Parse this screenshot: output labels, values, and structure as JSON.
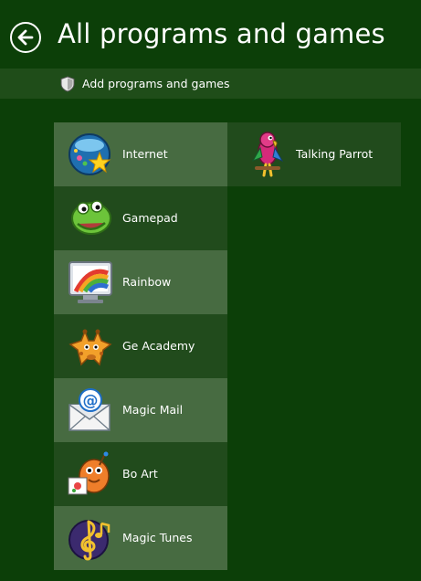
{
  "header": {
    "title": "All programs and games"
  },
  "add_bar": {
    "label": "Add programs and games"
  },
  "programs": [
    {
      "label": "Internet",
      "icon": "globe-star-icon"
    },
    {
      "label": "Gamepad",
      "icon": "snake-icon"
    },
    {
      "label": "Rainbow",
      "icon": "rainbow-monitor-icon"
    },
    {
      "label": "Ge Academy",
      "icon": "giraffe-icon"
    },
    {
      "label": "Magic Mail",
      "icon": "envelope-at-icon"
    },
    {
      "label": "Bo Art",
      "icon": "paint-creature-icon"
    },
    {
      "label": "Magic Tunes",
      "icon": "treble-clef-icon"
    },
    {
      "label": "Talking Parrot",
      "icon": "parrot-icon"
    }
  ],
  "colors": {
    "background": "#0c3f08",
    "tile_light": "#476b41",
    "tile_dark": "#214b1c",
    "bar": "#1f4d19"
  }
}
